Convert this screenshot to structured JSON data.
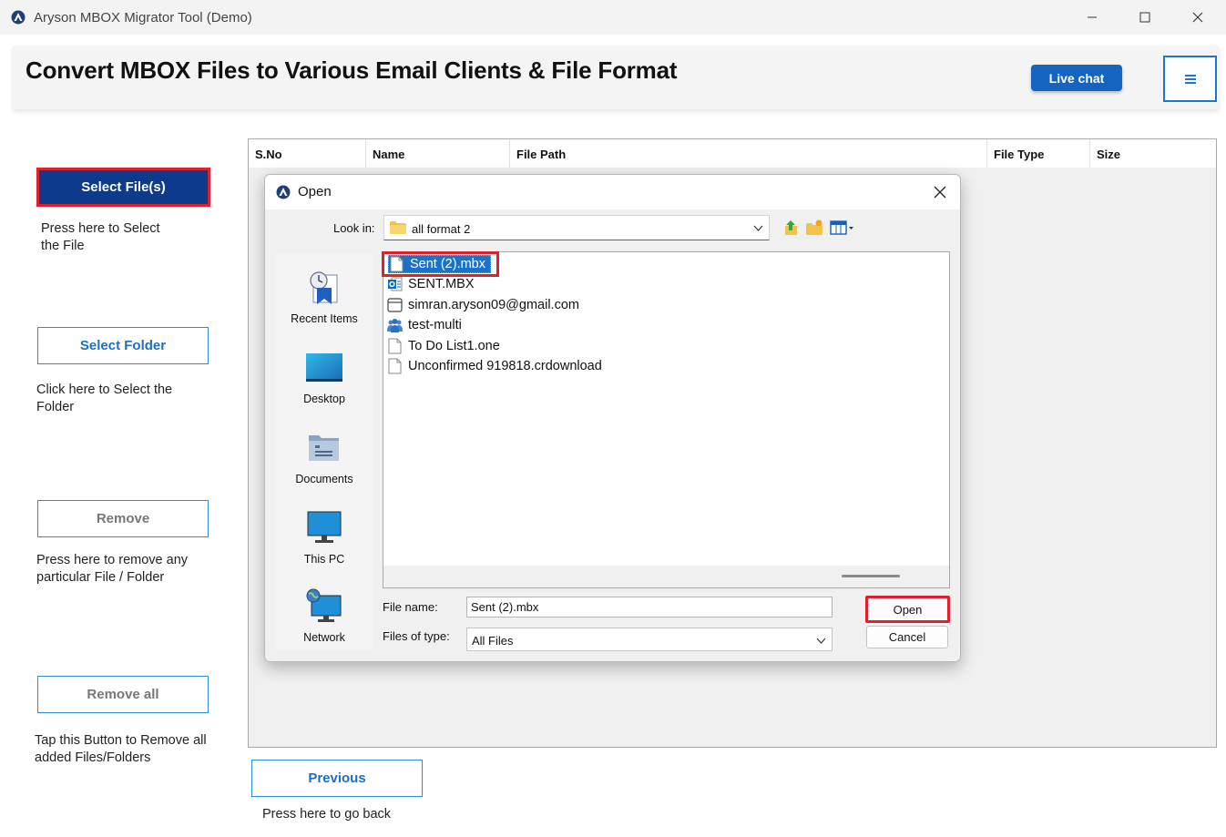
{
  "window": {
    "title": "Aryson MBOX Migrator Tool (Demo)"
  },
  "header": {
    "title": "Convert MBOX Files to Various Email Clients & File Format",
    "live_chat_label": "Live chat"
  },
  "sidebar": {
    "select_files": {
      "label": "Select File(s)",
      "description": "Press here to Select the File"
    },
    "select_folder": {
      "label": "Select Folder",
      "description": "Click here to Select the Folder"
    },
    "remove": {
      "label": "Remove",
      "description": "Press here to remove any particular File / Folder"
    },
    "remove_all": {
      "label": "Remove all",
      "description": "Tap this Button to Remove all added Files/Folders"
    }
  },
  "table": {
    "columns": [
      "S.No",
      "Name",
      "File Path",
      "File Type",
      "Size"
    ]
  },
  "footer": {
    "previous_label": "Previous",
    "previous_description": "Press here to go back"
  },
  "dialog": {
    "title": "Open",
    "look_in_label": "Look in:",
    "look_in_value": "all format 2",
    "places": [
      "Recent Items",
      "Desktop",
      "Documents",
      "This PC",
      "Network"
    ],
    "files": [
      {
        "name": "Sent (2).mbx",
        "icon": "blank-file-icon",
        "selected": true
      },
      {
        "name": "SENT.MBX",
        "icon": "outlook-file-icon",
        "selected": false
      },
      {
        "name": "simran.aryson09@gmail.com",
        "icon": "window-file-icon",
        "selected": false
      },
      {
        "name": "test-multi",
        "icon": "group-folder-icon",
        "selected": false
      },
      {
        "name": "To Do List1.one",
        "icon": "blank-file-icon",
        "selected": false
      },
      {
        "name": "Unconfirmed 919818.crdownload",
        "icon": "blank-file-icon",
        "selected": false
      }
    ],
    "file_name_label": "File name:",
    "file_name_value": "Sent (2).mbx",
    "files_of_type_label": "Files of type:",
    "files_of_type_value": "All Files",
    "open_label": "Open",
    "cancel_label": "Cancel"
  },
  "colors": {
    "primary_blue": "#0d3a8a",
    "accent_blue": "#1565c0",
    "highlight_red": "#e0202a",
    "selection_blue": "#1a73c8"
  }
}
